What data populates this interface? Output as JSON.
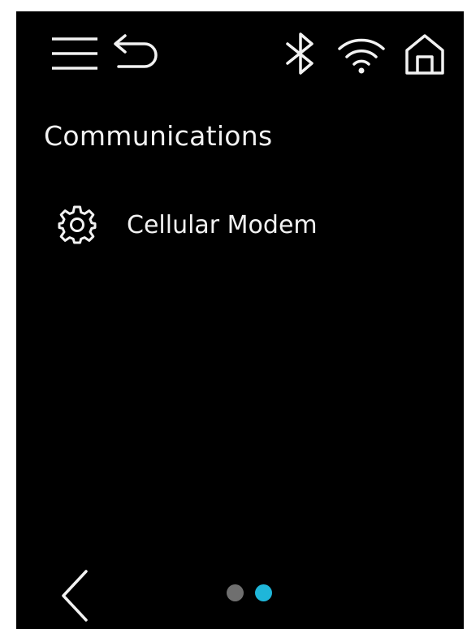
{
  "header": {
    "icons": [
      "menu-icon",
      "undo-icon",
      "bluetooth-icon",
      "wifi-icon",
      "home-icon"
    ]
  },
  "page": {
    "title": "Communications"
  },
  "menu": {
    "items": [
      {
        "icon": "gear-icon",
        "label": "Cellular Modem"
      }
    ]
  },
  "footer": {
    "pagination": {
      "total": 2,
      "active": 2
    },
    "colors": {
      "dot_inactive": "#6f6f6f",
      "dot_active": "#1fb6d9"
    }
  },
  "colors": {
    "background": "#000000",
    "text": "#f2f2f2"
  }
}
